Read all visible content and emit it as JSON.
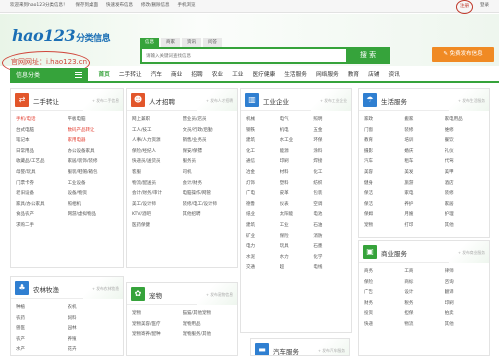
{
  "topbar": {
    "welcome": "欢迎来到hao123分类信息！",
    "links": [
      "保存到桌面",
      "快速发布信息",
      "修改/删除信息",
      "手机浏览"
    ],
    "register": "注册",
    "login": "登录"
  },
  "header": {
    "logo": "hao123",
    "logo_sub": "分类信息",
    "site_label": "官网网址：i.hao123.cn",
    "search": {
      "tabs": [
        "信息",
        "商家",
        "资讯",
        "问答"
      ],
      "placeholder": "请输入关键词查找信息",
      "button": "搜 索"
    },
    "post_button": "免费发布信息"
  },
  "nav": {
    "category_label": "信息分类",
    "items": [
      "首页",
      "二手转让",
      "汽车",
      "商业",
      "招聘",
      "农业",
      "工业",
      "医疗健康",
      "生活服务",
      "网络服务",
      "教育",
      "店铺",
      "资讯"
    ]
  },
  "colors": {
    "brand_green": "#36a33b",
    "orange": "#f08a24",
    "highlight_red": "#d0463b"
  },
  "panels": {
    "used": {
      "title": "二手转让",
      "more": "发布二手信息",
      "icon": "transfer-icon",
      "color": "#e2562b",
      "items": [
        {
          "t": "手机/电话",
          "red": true
        },
        {
          "t": "平板电脑",
          "red": false
        },
        {
          "t": "台式电脑",
          "red": false
        },
        {
          "t": "数码产品转让",
          "red": true
        },
        {
          "t": "笔记本",
          "red": false
        },
        {
          "t": "家用电器",
          "red": true
        },
        {
          "t": "日常用品",
          "red": false
        },
        {
          "t": "办公设备家具",
          "red": false
        },
        {
          "t": "收藏品/工艺品",
          "red": false
        },
        {
          "t": "家居/装饰/装修",
          "red": false
        },
        {
          "t": "母婴/玩具",
          "red": false
        },
        {
          "t": "服装/鞋帽/箱包",
          "red": false
        },
        {
          "t": "门票卡券",
          "red": false
        },
        {
          "t": "工业设备",
          "red": false
        },
        {
          "t": "老旧设备",
          "red": false
        },
        {
          "t": "设备/物资",
          "red": false
        },
        {
          "t": "家具/办公家具",
          "red": false
        },
        {
          "t": "照相机",
          "red": false
        },
        {
          "t": "食品农产",
          "red": false
        },
        {
          "t": "网游/虚拟物品",
          "red": false
        },
        {
          "t": "求购二手",
          "red": false
        },
        {
          "t": "",
          "red": false
        }
      ]
    },
    "recruit": {
      "title": "人才招聘",
      "more": "发布人才招聘",
      "icon": "recruit-icon",
      "color": "#e2562b",
      "items": [
        "网上兼职",
        "营业员/店员",
        "工人/技工",
        "文员/行政/后勤",
        "人事/人力资源",
        "销售/业务员",
        "保险/经纪人",
        "保安/保镖",
        "快递员/送货员",
        "服务员",
        "客服",
        "司机",
        "物流/配送员",
        "会计/财务",
        "会计/财务/审计",
        "电脑操作/网管",
        "美工/设计师",
        "装修/电工/设计师",
        "KTV/酒吧",
        "其他招聘",
        "医药保健",
        "",
        ""
      ]
    },
    "industry": {
      "title": "工业企业",
      "more": "发布工业企业",
      "icon": "factory-icon",
      "color": "#2f7fd1",
      "items": [
        "机械",
        "电气",
        "照明",
        "钢铁",
        "机电",
        "五金",
        "建筑",
        "水工业",
        "环保",
        "化工",
        "能源",
        "涂料",
        "通信",
        "印刷",
        "焊接",
        "冶金",
        "材料",
        "化工",
        "灯饰",
        "塑料",
        "纺织",
        "广电",
        "皮革",
        "包装",
        "德鲁",
        "仪表",
        "空调",
        "纸业",
        "太阳能",
        "电池",
        "建筑",
        "工业",
        "石油",
        "矿业",
        "保险",
        "消防",
        "电力",
        "玩具",
        "石墨",
        "水泥",
        "水力",
        "化学",
        "交通",
        "超",
        "电线"
      ]
    },
    "life": {
      "title": "生活服务",
      "more": "发布生活服务",
      "icon": "umbrella-icon",
      "color": "#2f7fd1",
      "items": [
        "家政",
        "搬家",
        "家电用品",
        "门窗",
        "装修",
        "维修",
        "教育",
        "培训",
        "餐饮",
        "摄影",
        "婚庆",
        "礼仪",
        "汽车",
        "租车",
        "代驾",
        "美容",
        "美发",
        "美甲",
        "健身",
        "旅游",
        "酒店",
        "保洁",
        "家电",
        "装修",
        "保洁",
        "养护",
        "家居",
        "保姆",
        "月嫂",
        "护理",
        "宠物",
        "打印",
        "其他"
      ]
    },
    "agri": {
      "title": "农林牧渔",
      "more": "发布农林牧渔",
      "icon": "tree-icon",
      "color": "#2f7fd1",
      "items": [
        "种植",
        "农机",
        "农药",
        "饲料",
        "兽医",
        "园林",
        "农产",
        "养殖",
        "水产",
        "花卉"
      ]
    },
    "pets": {
      "title": "宠物",
      "more": "发布宠物信息",
      "icon": "paw-icon",
      "color": "#36a33b",
      "items": [
        "宠物",
        "猫猫/其他宠物",
        "宠物美容/医疗",
        "宠物用品",
        "宠物寄养/配种",
        "宠物服务/其他"
      ]
    },
    "business": {
      "title": "商业服务",
      "more": "发布商业服务",
      "icon": "briefcase-icon",
      "color": "#36a33b",
      "items": [
        "商务",
        "工商",
        "律师",
        "保险",
        "商标",
        "咨询",
        "广告",
        "设计",
        "翻译",
        "财务",
        "税务",
        "印刷",
        "投资",
        "担保",
        "拍卖",
        "快递",
        "物流",
        "其他"
      ]
    },
    "car": {
      "title": "汽车服务",
      "more": "发布汽车服务",
      "icon": "car-icon",
      "color": "#2f7fd1"
    }
  }
}
